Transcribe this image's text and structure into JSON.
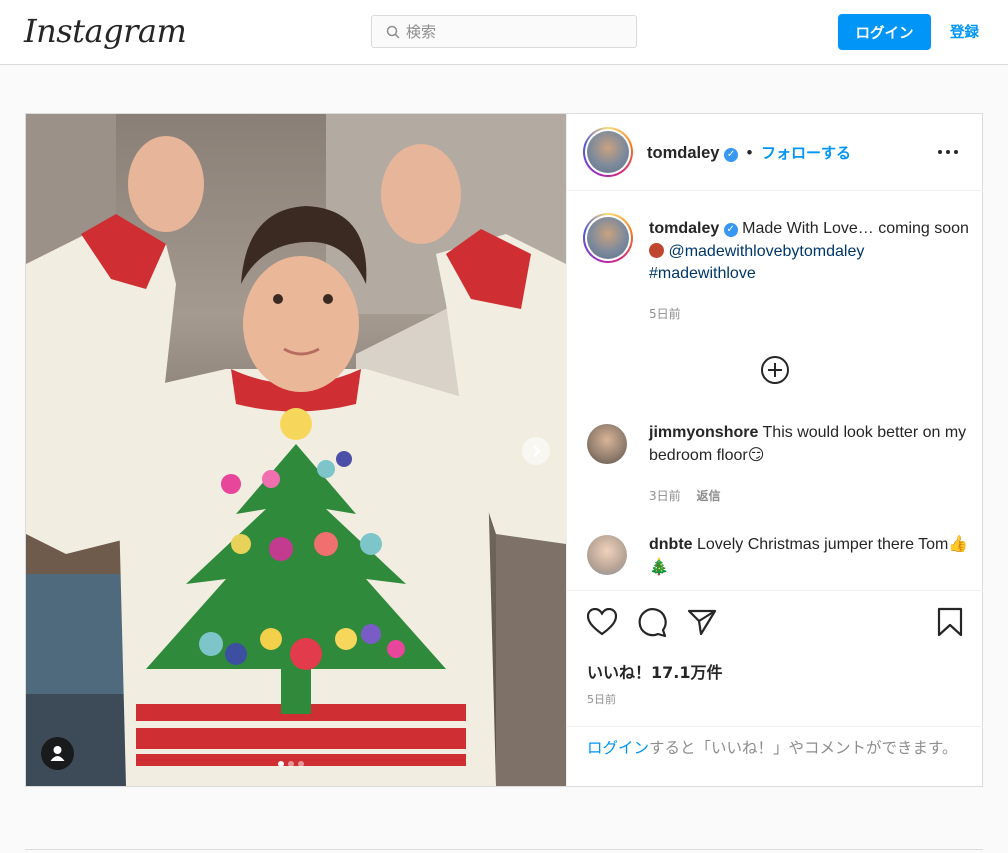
{
  "header": {
    "logo": "Instagram",
    "search_placeholder": "検索",
    "login_label": "ログイン",
    "signup_label": "登録"
  },
  "post": {
    "username": "tomdaley",
    "follow_label": "フォローする",
    "caption": {
      "text": "Made With Love… coming soon",
      "mention": "@madewithlovebytomdaley",
      "hashtag": "#madewithlove",
      "time": "5日前"
    },
    "comments": [
      {
        "username": "jimmyonshore",
        "text": "This would look better on my bedroom floor😏",
        "time": "3日前",
        "reply": "返信"
      },
      {
        "username": "dnbte",
        "text": "Lovely Christmas jumper there Tom👍 🎄"
      }
    ],
    "likes": "いいね！17.1万件",
    "date": "5日前",
    "login_prompt_link": "ログイン",
    "login_prompt_text": "すると「いいね！」やコメントができます。"
  },
  "colors": {
    "accent": "#0095f6",
    "link": "#00376b",
    "border": "#dbdbdb",
    "muted": "#8e8e8e"
  },
  "icons": [
    "search-icon",
    "verified-icon",
    "more-icon",
    "load-more-icon",
    "heart-icon",
    "comment-icon",
    "share-icon",
    "bookmark-icon",
    "next-arrow-icon",
    "user-tag-icon"
  ]
}
